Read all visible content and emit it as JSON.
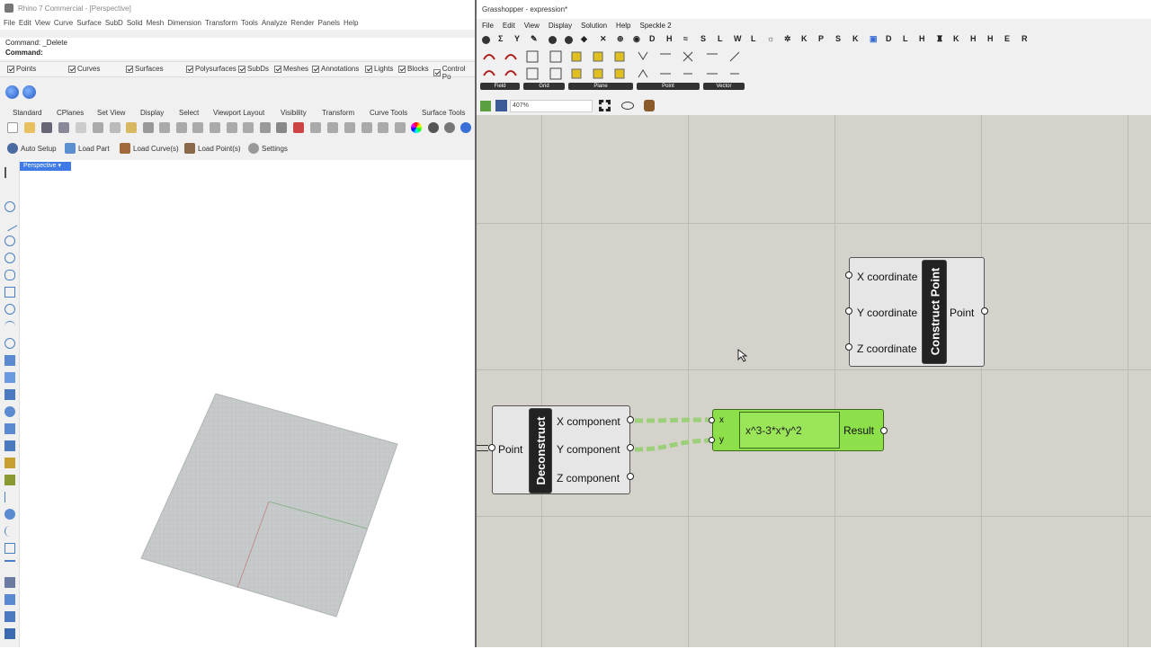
{
  "rhino": {
    "title": "Rhino 7 Commercial - [Perspective]",
    "menu": [
      "File",
      "Edit",
      "View",
      "Curve",
      "Surface",
      "SubD",
      "Solid",
      "Mesh",
      "Dimension",
      "Transform",
      "Tools",
      "Analyze",
      "Render",
      "Panels",
      "Help"
    ],
    "command_history": "Command: _Delete",
    "command_prompt": "Command:",
    "osnaps": [
      "Points",
      "Curves",
      "Surfaces",
      "Polysurfaces",
      "SubDs",
      "Meshes",
      "Annotations",
      "Lights",
      "Blocks",
      "Control Po"
    ],
    "tabs": [
      "Standard",
      "CPlanes",
      "Set View",
      "Display",
      "Select",
      "Viewport Layout",
      "Visibility",
      "Transform",
      "Curve Tools",
      "Surface Tools"
    ],
    "commands": [
      "Auto Setup",
      "Load Part",
      "Load Curve(s)",
      "Load Point(s)",
      "Settings"
    ],
    "viewport_tab": "Perspective"
  },
  "gh": {
    "title": "Grasshopper - expression*",
    "menu": [
      "File",
      "Edit",
      "View",
      "Display",
      "Solution",
      "Help",
      "Speckle 2"
    ],
    "letter_tabs": [
      "D",
      "H",
      "S",
      "L",
      "W",
      "L",
      "K",
      "P",
      "S",
      "K",
      "D",
      "L",
      "H",
      "K",
      "H",
      "H",
      "R"
    ],
    "ribbon_groups": [
      "Field",
      "Grid",
      "Plane",
      "Point",
      "Vector"
    ],
    "zoom": "407%",
    "construct_point": {
      "name": "Construct Point",
      "inputs": [
        "X coordinate",
        "Y coordinate",
        "Z coordinate"
      ],
      "output": "Point"
    },
    "deconstruct": {
      "name": "Deconstruct",
      "input": "Point",
      "outputs": [
        "X component",
        "Y component",
        "Z component"
      ]
    },
    "expression": {
      "inputs": [
        "x",
        "y"
      ],
      "formula": "x^3-3*x*y^2",
      "output": "Result"
    }
  },
  "colors": {
    "expression_fill": "#8ee04a",
    "wire": "#9ccf7a",
    "canvas": "#d4d2ca",
    "viewport_tab": "#3f7be6"
  }
}
